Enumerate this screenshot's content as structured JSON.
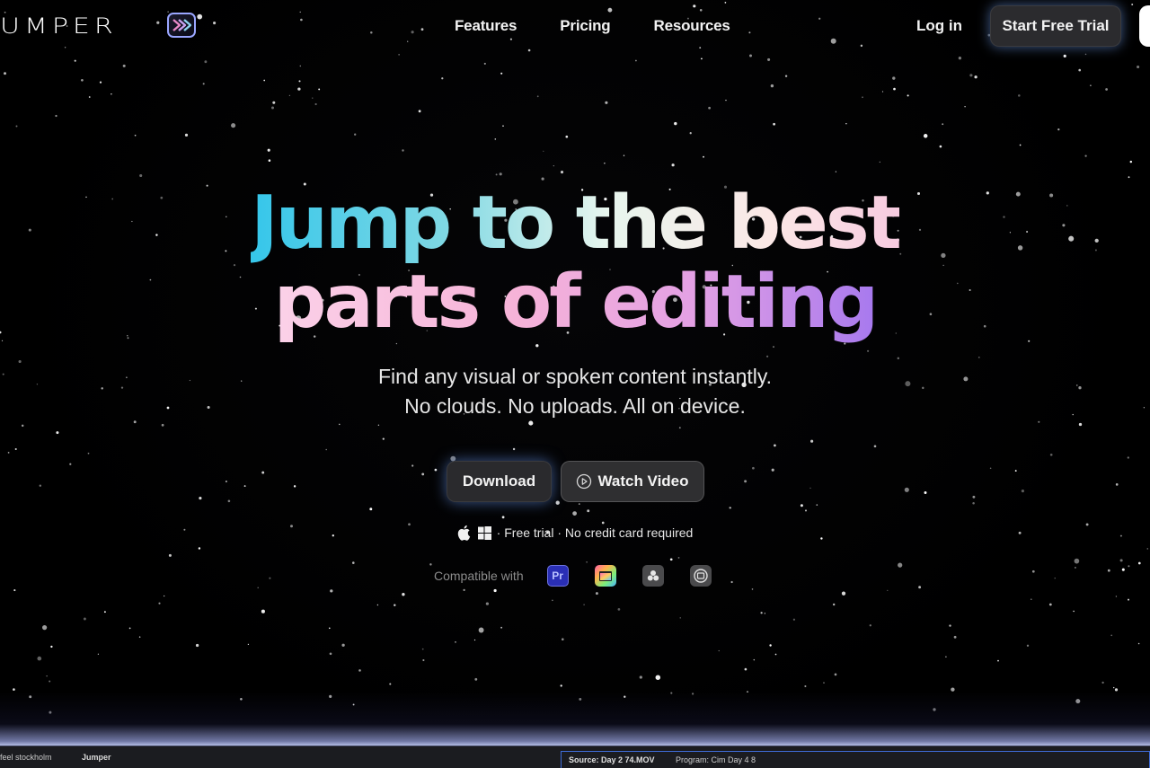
{
  "nav": {
    "logo_text": "UMPER",
    "links": [
      "Features",
      "Pricing",
      "Resources"
    ],
    "login": "Log in",
    "trial_button": "Start Free Trial"
  },
  "hero": {
    "headline_line1": "Jump to the best",
    "headline_line2": "parts of editing",
    "subtitle_line1": "Find any visual or spoken content instantly.",
    "subtitle_line2": "No clouds. No uploads. All on device.",
    "download_button": "Download",
    "watch_button": "Watch Video",
    "platform_note": "· Free trial · No credit card required",
    "compatible_label": "Compatible with",
    "compatible_apps": [
      "Pr",
      "final-cut-pro-icon",
      "davinci-resolve-icon",
      "capcut-icon"
    ]
  },
  "bottom": {
    "left_text": "feel stockholm",
    "panel_name": "Jumper",
    "source_label": "Source: Day 2 74.MOV",
    "program_label": "Program: Cim Day 4 8"
  },
  "colors": {
    "background": "#000000",
    "button_bg": "#2b2b2e",
    "glow": "#78aaff",
    "gradient_cyan": "#35c6ea",
    "gradient_pink": "#f6b3d8",
    "gradient_purple": "#a779ee"
  }
}
